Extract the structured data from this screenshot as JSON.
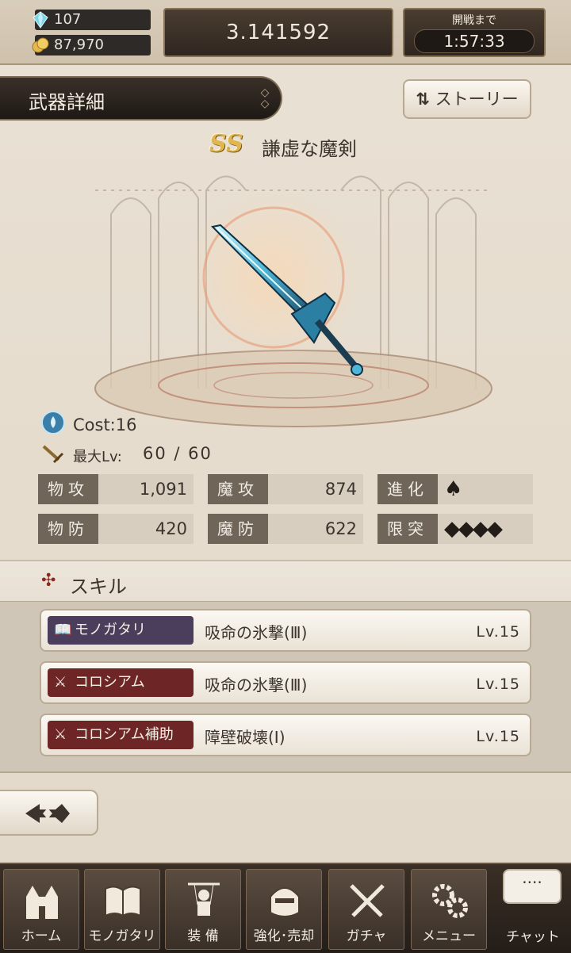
{
  "resources": {
    "gems": "107",
    "gold": "87,970"
  },
  "points": "3.141592",
  "battle": {
    "label": "開戦まで",
    "time": "1:57:33"
  },
  "header": {
    "title": "武器詳細",
    "story_button": "ストーリー"
  },
  "weapon": {
    "rank": "SS",
    "name": "謙虚な魔剣",
    "cost": "Cost:16",
    "max_lv_label": "最大Lv:",
    "max_lv_value": "60 / 60"
  },
  "stats": {
    "phys_atk_label": "物攻",
    "phys_atk": "1,091",
    "mag_atk_label": "魔攻",
    "mag_atk": "874",
    "evolve_label": "進化",
    "evolve_icons": "♠",
    "phys_def_label": "物防",
    "phys_def": "420",
    "mag_def_label": "魔防",
    "mag_def": "622",
    "limit_label": "限突",
    "limit_icons": "◆◆◆◆"
  },
  "skills": {
    "section_title": "スキル",
    "items": [
      {
        "tag": "モノガタリ",
        "name": "吸命の氷撃(Ⅲ)",
        "level": "Lv.15",
        "tag_color": "#4b3d5c"
      },
      {
        "tag": "コロシアム",
        "name": "吸命の氷撃(Ⅲ)",
        "level": "Lv.15",
        "tag_color": "#6e2525"
      },
      {
        "tag": "コロシアム補助",
        "name": "障壁破壊(Ⅰ)",
        "level": "Lv.15",
        "tag_color": "#6e2525"
      }
    ]
  },
  "nav": {
    "home": "ホーム",
    "story": "モノガタリ",
    "equip": "装 備",
    "enhance": "強化･売却",
    "gacha": "ガチャ",
    "menu": "メニュー",
    "chat": "チャット",
    "chat_bubble": "····"
  }
}
